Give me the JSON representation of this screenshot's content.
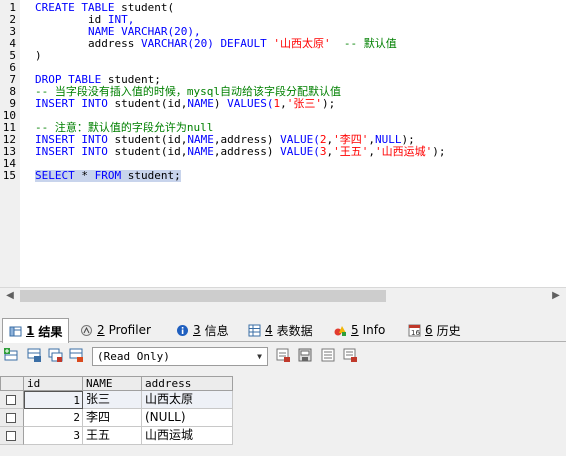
{
  "editor": {
    "line_numbers": [
      "1",
      "2",
      "3",
      "4",
      "5",
      "6",
      "7",
      "8",
      "9",
      "10",
      "11",
      "12",
      "13",
      "14",
      "15"
    ],
    "lines": [
      [
        {
          "t": "CREATE TABLE ",
          "c": "kw"
        },
        {
          "t": "student(",
          "c": "plain"
        }
      ],
      [
        {
          "t": "        id ",
          "c": "plain"
        },
        {
          "t": "INT,",
          "c": "kw"
        }
      ],
      [
        {
          "t": "        NAME ",
          "c": "kw"
        },
        {
          "t": "VARCHAR(20),",
          "c": "kw"
        }
      ],
      [
        {
          "t": "        address ",
          "c": "plain"
        },
        {
          "t": "VARCHAR(20) DEFAULT ",
          "c": "kw"
        },
        {
          "t": "'山西太原'",
          "c": "str"
        },
        {
          "t": "  -- 默认值",
          "c": "cm"
        }
      ],
      [
        {
          "t": ")",
          "c": "plain"
        }
      ],
      [],
      [
        {
          "t": "DROP TABLE ",
          "c": "kw"
        },
        {
          "t": "student;",
          "c": "plain"
        }
      ],
      [
        {
          "t": "-- 当字段没有插入值的时候，mysql自动给该字段分配默认值",
          "c": "cm"
        }
      ],
      [
        {
          "t": "INSERT INTO ",
          "c": "kw"
        },
        {
          "t": "student(id,",
          "c": "plain"
        },
        {
          "t": "NAME",
          "c": "kw"
        },
        {
          "t": ") ",
          "c": "plain"
        },
        {
          "t": "VALUES(",
          "c": "kw"
        },
        {
          "t": "1",
          "c": "num"
        },
        {
          "t": ",",
          "c": "plain"
        },
        {
          "t": "'张三'",
          "c": "str"
        },
        {
          "t": ");",
          "c": "plain"
        }
      ],
      [],
      [
        {
          "t": "-- 注意：默认值的字段允许为null",
          "c": "cm"
        }
      ],
      [
        {
          "t": "INSERT INTO ",
          "c": "kw"
        },
        {
          "t": "student(id,",
          "c": "plain"
        },
        {
          "t": "NAME",
          "c": "kw"
        },
        {
          "t": ",address) ",
          "c": "plain"
        },
        {
          "t": "VALUE(",
          "c": "kw"
        },
        {
          "t": "2",
          "c": "num"
        },
        {
          "t": ",",
          "c": "plain"
        },
        {
          "t": "'李四'",
          "c": "str"
        },
        {
          "t": ",",
          "c": "plain"
        },
        {
          "t": "NULL",
          "c": "kw"
        },
        {
          "t": ");",
          "c": "plain"
        }
      ],
      [
        {
          "t": "INSERT INTO ",
          "c": "kw"
        },
        {
          "t": "student(id,",
          "c": "plain"
        },
        {
          "t": "NAME",
          "c": "kw"
        },
        {
          "t": ",address) ",
          "c": "plain"
        },
        {
          "t": "VALUE(",
          "c": "kw"
        },
        {
          "t": "3",
          "c": "num"
        },
        {
          "t": ",",
          "c": "plain"
        },
        {
          "t": "'王五'",
          "c": "str"
        },
        {
          "t": ",",
          "c": "plain"
        },
        {
          "t": "'山西运城'",
          "c": "str"
        },
        {
          "t": ");",
          "c": "plain"
        }
      ],
      [],
      [
        {
          "t": "SELECT ",
          "c": "kw"
        },
        {
          "t": "* ",
          "c": "plain"
        },
        {
          "t": "FROM ",
          "c": "kw"
        },
        {
          "t": "student;",
          "c": "plain"
        }
      ]
    ]
  },
  "tabs": [
    {
      "key": "1",
      "label": "结果",
      "icon": "result-grid-icon"
    },
    {
      "key": "2",
      "label": "Profiler",
      "icon": "profiler-icon"
    },
    {
      "key": "3",
      "label": "信息",
      "icon": "info-icon"
    },
    {
      "key": "4",
      "label": "表数据",
      "icon": "table-data-icon"
    },
    {
      "key": "5",
      "label": "Info",
      "icon": "info-shapes-icon"
    },
    {
      "key": "6",
      "label": "历史",
      "icon": "history-icon"
    }
  ],
  "toolbar": {
    "select_value": "(Read Only)"
  },
  "result": {
    "columns": [
      "id",
      "NAME",
      "address"
    ],
    "rows": [
      [
        "1",
        "张三",
        "山西太原"
      ],
      [
        "2",
        "李四",
        "(NULL)"
      ],
      [
        "3",
        "王五",
        "山西运城"
      ]
    ]
  },
  "colors": {
    "keyword": "#0000ff",
    "comment": "#008000",
    "string": "#ff0000",
    "selection": "#c8d4ec"
  }
}
